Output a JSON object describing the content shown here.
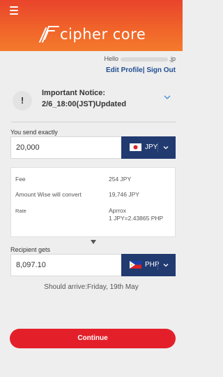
{
  "header": {
    "brand": "cipher core",
    "colors": {
      "top": "#e9442c",
      "bottom": "#f47a2c"
    }
  },
  "account": {
    "greeting_prefix": "Hello",
    "greeting_suffix": ".jp",
    "edit_profile": "Edit Profile",
    "separator": "|",
    "sign_out": "Sign Out"
  },
  "notice": {
    "badge": "!",
    "title": "Important Notice:",
    "subtitle": "2/6_18:00(JST)Updated"
  },
  "send": {
    "label": "You send exactly",
    "amount": "20,000",
    "currency": "JPY",
    "flag_icon": "japan-flag-icon"
  },
  "details": {
    "fee_label": "Fee",
    "fee_value": "254 JPY",
    "convert_label": "Amount Wise will convert",
    "convert_value": "19,746 JPY",
    "rate_label": "Rate",
    "rate_value_1": "Aprrox",
    "rate_value_2": "1 JPY=2.43865 PHP"
  },
  "receive": {
    "label": "Recipient gets",
    "amount": "8,097.10",
    "currency": "PHP",
    "flag_icon": "philippines-flag-icon"
  },
  "arrival": "Should arrive:Friday, 19th May",
  "continue_label": "Continue",
  "colors": {
    "accent": "#e3202a",
    "currency_button": "#213a70",
    "link": "#1f4e92"
  }
}
